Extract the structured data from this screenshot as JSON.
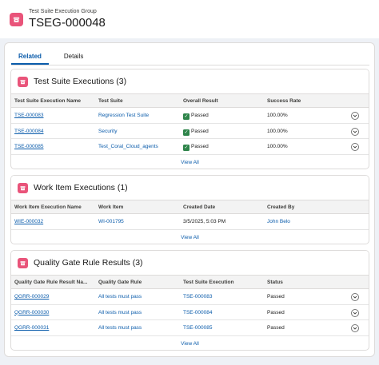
{
  "header": {
    "kicker": "Test Suite Execution Group",
    "title": "TSEG-000048"
  },
  "tabs": [
    {
      "label": "Related",
      "active": true
    },
    {
      "label": "Details",
      "active": false
    }
  ],
  "colors": {
    "accent": "#0b5cab",
    "icon": "#e9547a",
    "passed": "#2e844a"
  },
  "test_suite_executions": {
    "title": "Test Suite Executions (3)",
    "columns": [
      "Test Suite Execution Name",
      "Test Suite",
      "Overall Result",
      "Success Rate"
    ],
    "rows": [
      [
        "TSE-000083",
        "Regression Test Suite",
        "Passed",
        "100.00%"
      ],
      [
        "TSE-000084",
        "Security",
        "Passed",
        "100.00%"
      ],
      [
        "TSE-000085",
        "Test_Coral_Cloud_agents",
        "Passed",
        "100.00%"
      ]
    ],
    "view_all": "View All"
  },
  "work_item_executions": {
    "title": "Work Item Executions (1)",
    "columns": [
      "Work Item Execution Name",
      "Work Item",
      "Created Date",
      "Created By"
    ],
    "rows": [
      [
        "WIE-000032",
        "WI-001795",
        "3/5/2025, 5:03 PM",
        "John Belo"
      ]
    ],
    "view_all": "View All"
  },
  "quality_gate_rule_results": {
    "title": "Quality Gate Rule Results (3)",
    "columns": [
      "Quality Gate Rule Result Na...",
      "Quality Gate Rule",
      "Test Suite Execution",
      "Status"
    ],
    "rows": [
      [
        "QGRR-000029",
        "All tests must pass",
        "TSE-000083",
        "Passed"
      ],
      [
        "QGRR-000030",
        "All tests must pass",
        "TSE-000084",
        "Passed"
      ],
      [
        "QGRR-000031",
        "All tests must pass",
        "TSE-000085",
        "Passed"
      ]
    ],
    "view_all": "View All"
  },
  "icons": {
    "record_icon": "stacked-box-icon",
    "row_action": "chevron-down-icon",
    "result_check": "check-icon"
  }
}
